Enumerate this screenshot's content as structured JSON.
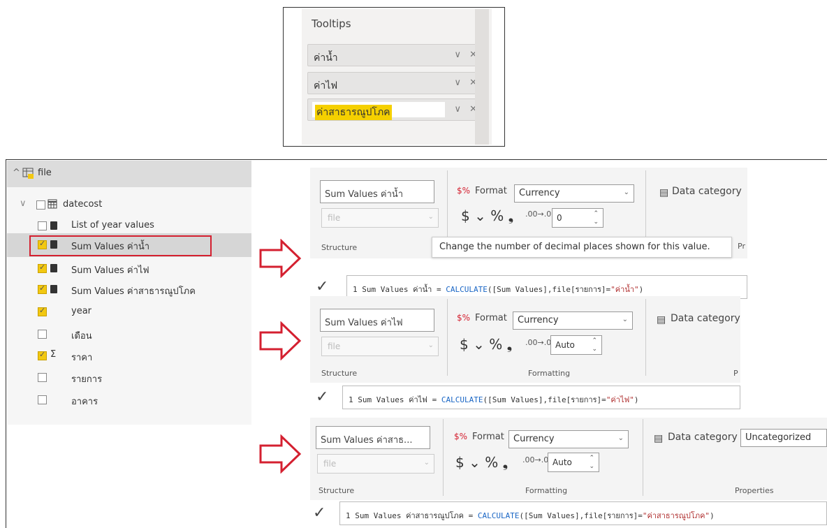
{
  "tooltips": {
    "title": "Tooltips",
    "items": [
      "ค่าน้ำ",
      "ค่าไฟ",
      "ค่าสาธารณูปโภค"
    ],
    "icons": "∨ ✕"
  },
  "fields": {
    "table": "file",
    "items": [
      {
        "label": "datecost",
        "checked": false,
        "icon": "calendar-table-icon"
      },
      {
        "label": "List of year values",
        "checked": false,
        "icon": "calculator-icon"
      },
      {
        "label": "Sum Values ค่าน้ำ",
        "checked": true,
        "icon": "calculator-icon"
      },
      {
        "label": "Sum Values ค่าไฟ",
        "checked": true,
        "icon": "calculator-icon"
      },
      {
        "label": "Sum Values ค่าสาธารณูปโภค",
        "checked": true,
        "icon": "calculator-icon"
      },
      {
        "label": "year",
        "checked": true,
        "icon": ""
      },
      {
        "label": "เดือน",
        "checked": false,
        "icon": ""
      },
      {
        "label": "ราคา",
        "checked": true,
        "icon": "sigma-icon"
      },
      {
        "label": "รายการ",
        "checked": false,
        "icon": ""
      },
      {
        "label": "อาคาร",
        "checked": false,
        "icon": ""
      }
    ],
    "highlight_color": "#d42030"
  },
  "ribbons": [
    {
      "name": "Sum Values ค่าน้ำ",
      "table": "file",
      "format_label": "Format",
      "format_value": "Currency",
      "symbols": "$ ⌄ % ❟",
      "decimals": "0",
      "data_category": "Data category",
      "category_value": "",
      "structure": "Structure",
      "formatting": "",
      "properties": "Pr",
      "formula": {
        "line": "1",
        "name": "Sum Values ค่าน้ำ",
        "eq": " = ",
        "fn": "CALCULATE",
        "args": "([Sum Values],file[รายการ]=",
        "str": "\"ค่าน้ำ\"",
        "end": ")"
      },
      "tooltip": "Change the number of decimal places shown for this value."
    },
    {
      "name": "Sum Values ค่าไฟ",
      "table": "file",
      "format_label": "Format",
      "format_value": "Currency",
      "symbols": "$ ⌄ % ❟",
      "decimals": "Auto",
      "data_category": "Data category",
      "category_value": "",
      "structure": "Structure",
      "formatting": "Formatting",
      "properties": "P",
      "formula": {
        "line": "1",
        "name": "Sum Values ค่าไฟ",
        "eq": " = ",
        "fn": "CALCULATE",
        "args": "([Sum Values],file[รายการ]=",
        "str": "\"ค่าไฟ\"",
        "end": ")"
      }
    },
    {
      "name": "Sum Values ค่าสาธ...",
      "table": "file",
      "format_label": "Format",
      "format_value": "Currency",
      "symbols": "$ ⌄ % ❟",
      "decimals": "Auto",
      "data_category": "Data category",
      "category_value": "Uncategorized",
      "structure": "Structure",
      "formatting": "Formatting",
      "properties": "Properties",
      "formula": {
        "line": "1",
        "name": "Sum Values ค่าสาธารณูปโภค",
        "eq": " = ",
        "fn": "CALCULATE",
        "args": "([Sum Values],file[รายการ]=",
        "str": "\"ค่าสาธารณูปโภค\"",
        "end": ")"
      }
    }
  ]
}
